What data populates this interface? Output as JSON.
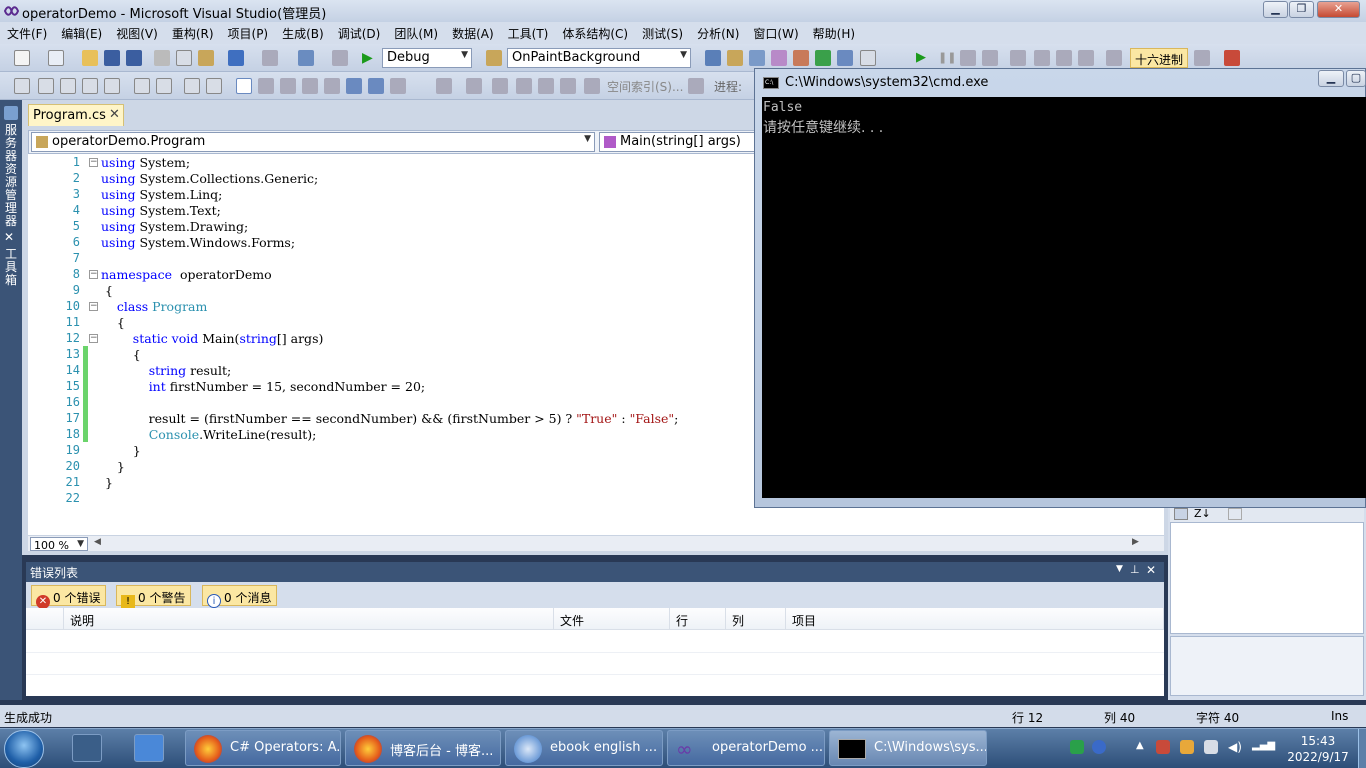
{
  "window": {
    "title": "operatorDemo - Microsoft Visual Studio(管理员)",
    "minimize_icon": "minimize-icon",
    "restore_icon": "restore-icon",
    "close_icon": "close-icon"
  },
  "menu": [
    "文件(F)",
    "编辑(E)",
    "视图(V)",
    "重构(R)",
    "项目(P)",
    "生成(B)",
    "调试(D)",
    "团队(M)",
    "数据(A)",
    "工具(T)",
    "体系结构(C)",
    "测试(S)",
    "分析(N)",
    "窗口(W)",
    "帮助(H)"
  ],
  "toolbar": {
    "config": "Debug",
    "target": "OnPaintBackground",
    "hex_label": "十六进制",
    "process_label": "进程:",
    "index_label": "空间索引(S)..."
  },
  "left_strip": {
    "server_explorer": "服务器资源管理器",
    "toolbox": "工具箱"
  },
  "editor": {
    "tab_label": "Program.cs",
    "class_combo": "operatorDemo.Program",
    "member_combo": "Main(string[] args)",
    "zoom": "100 %",
    "lines": [
      {
        "n": "1",
        "parts": [
          [
            "kw",
            "using"
          ],
          [
            "",
            "System;"
          ]
        ]
      },
      {
        "n": "2",
        "parts": [
          [
            "kw",
            "using"
          ],
          [
            "",
            "System.Collections.Generic;"
          ]
        ]
      },
      {
        "n": "3",
        "parts": [
          [
            "kw",
            "using"
          ],
          [
            "",
            "System.Linq;"
          ]
        ]
      },
      {
        "n": "4",
        "parts": [
          [
            "kw",
            "using"
          ],
          [
            "",
            "System.Text;"
          ]
        ]
      },
      {
        "n": "5",
        "parts": [
          [
            "kw",
            "using"
          ],
          [
            "",
            "System.Drawing;"
          ]
        ]
      },
      {
        "n": "6",
        "parts": [
          [
            "kw",
            "using"
          ],
          [
            "",
            "System.Windows.Forms;"
          ]
        ]
      },
      {
        "n": "7",
        "parts": []
      },
      {
        "n": "8",
        "parts": [
          [
            "kw",
            "namespace"
          ],
          [
            "",
            " operatorDemo"
          ]
        ]
      },
      {
        "n": "9",
        "parts": [
          [
            "",
            " {"
          ]
        ]
      },
      {
        "n": "10",
        "parts": [
          [
            "",
            "    "
          ],
          [
            "kw",
            "class"
          ],
          [
            "",
            ""
          ],
          [
            "ty",
            " Program"
          ]
        ]
      },
      {
        "n": "11",
        "parts": [
          [
            "",
            "    {"
          ]
        ]
      },
      {
        "n": "12",
        "parts": [
          [
            "",
            "        "
          ],
          [
            "kw",
            "static void"
          ],
          [
            "",
            " Main("
          ],
          [
            "kw",
            "string"
          ],
          [
            "",
            "[] args)"
          ]
        ]
      },
      {
        "n": "13",
        "parts": [
          [
            "",
            "        {"
          ]
        ]
      },
      {
        "n": "14",
        "parts": [
          [
            "",
            "            "
          ],
          [
            "kw",
            "string"
          ],
          [
            "",
            " result;"
          ]
        ]
      },
      {
        "n": "15",
        "parts": [
          [
            "",
            "            "
          ],
          [
            "kw",
            "int"
          ],
          [
            "",
            " firstNumber = 15, secondNumber = 20;"
          ]
        ]
      },
      {
        "n": "16",
        "parts": []
      },
      {
        "n": "17",
        "parts": [
          [
            "",
            "            result = (firstNumber == secondNumber) && (firstNumber > 5) ? "
          ],
          [
            "str",
            "\"True\""
          ],
          [
            "",
            " : "
          ],
          [
            "str",
            "\"False\""
          ],
          [
            "",
            ";"
          ]
        ]
      },
      {
        "n": "18",
        "parts": [
          [
            "",
            "            "
          ],
          [
            "ty",
            "Console"
          ],
          [
            "",
            ".WriteLine(result);"
          ]
        ]
      },
      {
        "n": "19",
        "parts": [
          [
            "",
            "        }"
          ]
        ]
      },
      {
        "n": "20",
        "parts": [
          [
            "",
            "    }"
          ]
        ]
      },
      {
        "n": "21",
        "parts": [
          [
            "",
            " }"
          ]
        ]
      },
      {
        "n": "22",
        "parts": []
      }
    ]
  },
  "error_list": {
    "title": "错误列表",
    "errors": "0 个错误",
    "warnings": "0 个警告",
    "messages": "0 个消息",
    "columns": [
      "说明",
      "文件",
      "行",
      "列",
      "项目"
    ]
  },
  "status": {
    "left": "生成成功",
    "line": "行 12",
    "col": "列 40",
    "char": "字符 40",
    "mode": "Ins"
  },
  "cmd": {
    "title": "C:\\Windows\\system32\\cmd.exe",
    "output_line1": "False",
    "output_line2": "请按任意键继续. . ."
  },
  "taskbar": {
    "tasks": [
      "C# Operators: A...",
      "博客后台 - 博客...",
      "ebook english ...",
      "operatorDemo ...",
      "C:\\Windows\\sys..."
    ],
    "time": "15:43",
    "date": "2022/9/17"
  }
}
